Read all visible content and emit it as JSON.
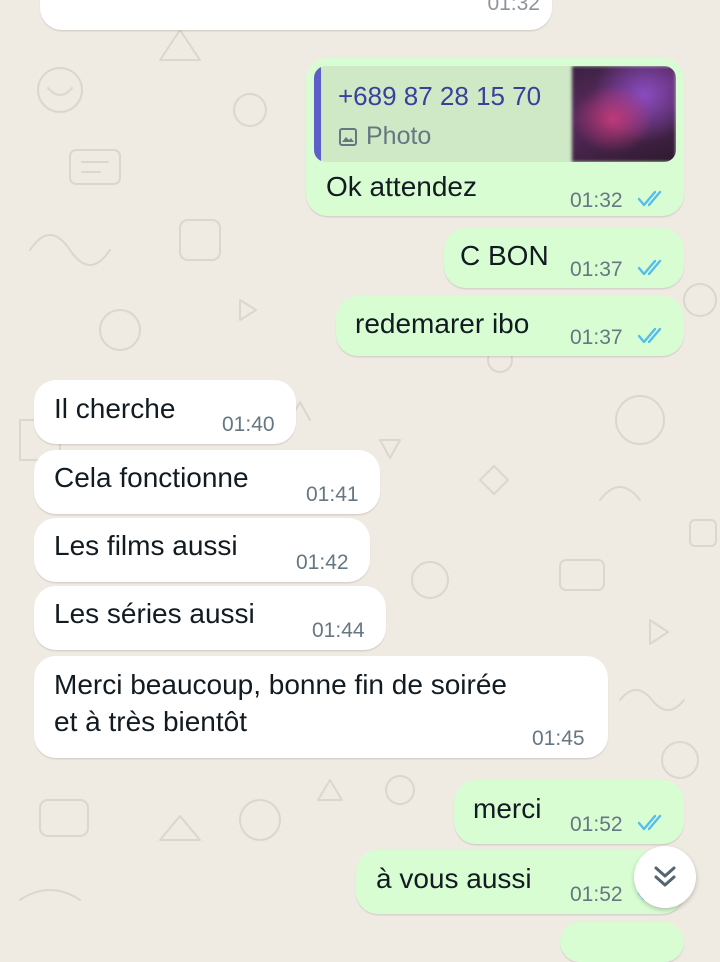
{
  "messages": [
    {
      "dir": "out",
      "reply": {
        "sender": "+689 87 28 15 70",
        "type": "Photo"
      },
      "text": "Ok attendez",
      "time": "01:32",
      "read": true
    },
    {
      "dir": "out",
      "text": "C BON",
      "time": "01:37",
      "read": true
    },
    {
      "dir": "out",
      "text": "redemarer ibo",
      "time": "01:37",
      "read": true
    },
    {
      "dir": "in",
      "text": "Il cherche",
      "time": "01:40"
    },
    {
      "dir": "in",
      "text": "Cela fonctionne",
      "time": "01:41"
    },
    {
      "dir": "in",
      "text": "Les films aussi",
      "time": "01:42"
    },
    {
      "dir": "in",
      "text": "Les séries aussi",
      "time": "01:44"
    },
    {
      "dir": "in",
      "text": [
        "Merci beaucoup, bonne fin de soirée",
        "et à très bientôt"
      ],
      "time": "01:45"
    },
    {
      "dir": "out",
      "text": "merci",
      "time": "01:52",
      "read": true
    },
    {
      "dir": "out",
      "text": "à vous aussi",
      "time": "01:52",
      "read": true
    }
  ],
  "partial_top_time": "01:32",
  "icons": {
    "read_receipt": "double-check-icon",
    "photo": "photo-icon",
    "scroll": "double-chevron-down-icon"
  },
  "colors": {
    "incoming": "#ffffff",
    "outgoing": "#d9fdd3",
    "read_tick": "#53bdeb",
    "chat_bg": "#efeae2"
  }
}
